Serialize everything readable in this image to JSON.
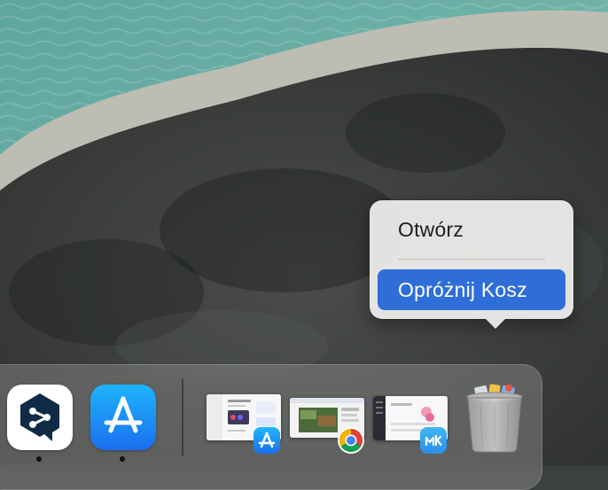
{
  "context_menu": {
    "items": [
      {
        "label": "Otwórz",
        "highlighted": false
      },
      {
        "label": "Opróżnij Kosz",
        "highlighted": true
      }
    ],
    "highlight_color": "#2f6ed8"
  },
  "dock": {
    "apps": [
      {
        "icon": "deepl-icon",
        "running": true
      },
      {
        "icon": "app-store-icon",
        "running": true
      }
    ],
    "minimized_windows": [
      {
        "app_badge": "app-store-icon"
      },
      {
        "app_badge": "chrome-icon"
      },
      {
        "app_badge": "mk-icon"
      }
    ],
    "trash": {
      "icon": "trash-full-icon"
    }
  }
}
